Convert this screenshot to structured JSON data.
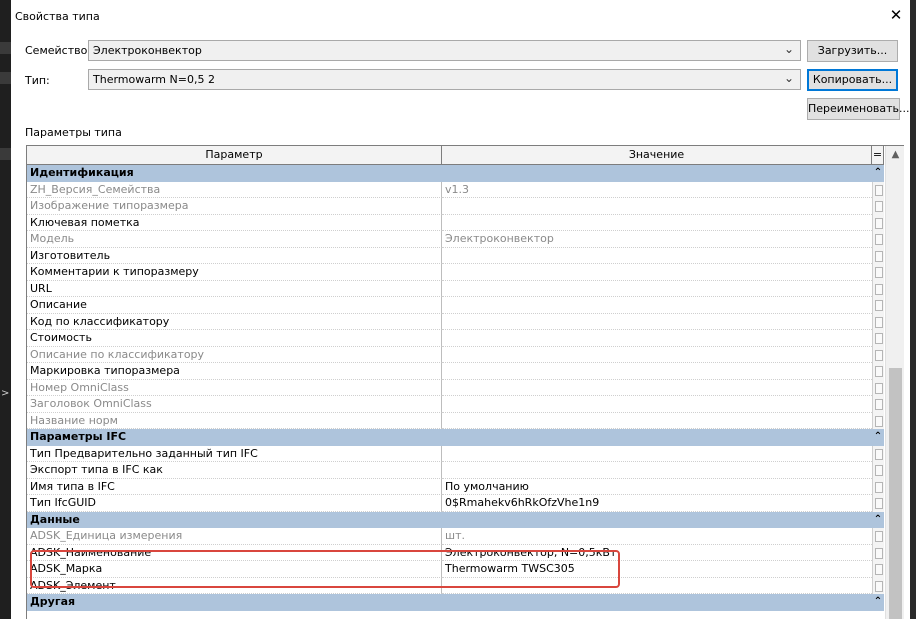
{
  "window": {
    "title": "Свойства типа",
    "close_glyph": "✕"
  },
  "family": {
    "label": "Семейство:",
    "value": "Электроконвектор",
    "load_button": "Загрузить..."
  },
  "type": {
    "label": "Тип:",
    "value": "Thermowarm N=0,5 2",
    "copy_button": "Копировать...",
    "rename_button": "Переименовать..."
  },
  "section_label": "Параметры типа",
  "grid": {
    "col_param": "Параметр",
    "col_value": "Значение",
    "col_eq": "=",
    "groups": [
      {
        "name": "Идентификация",
        "rows": [
          {
            "param": "ZH_Версия_Семейства",
            "value": "v1.3",
            "disabled": true
          },
          {
            "param": "Изображение типоразмера",
            "value": "",
            "disabled": true
          },
          {
            "param": "Ключевая пометка",
            "value": "",
            "disabled": false
          },
          {
            "param": "Модель",
            "value": "Электроконвектор",
            "disabled": true
          },
          {
            "param": "Изготовитель",
            "value": "",
            "disabled": false
          },
          {
            "param": "Комментарии к типоразмеру",
            "value": "",
            "disabled": false
          },
          {
            "param": "URL",
            "value": "",
            "disabled": false
          },
          {
            "param": "Описание",
            "value": "",
            "disabled": false
          },
          {
            "param": "Код по классификатору",
            "value": "",
            "disabled": false
          },
          {
            "param": "Стоимость",
            "value": "",
            "disabled": false
          },
          {
            "param": "Описание по классификатору",
            "value": "",
            "disabled": true
          },
          {
            "param": "Маркировка типоразмера",
            "value": "",
            "disabled": false
          },
          {
            "param": "Номер OmniClass",
            "value": "",
            "disabled": true
          },
          {
            "param": "Заголовок OmniClass",
            "value": "",
            "disabled": true
          },
          {
            "param": "Название норм",
            "value": "",
            "disabled": true
          }
        ]
      },
      {
        "name": "Параметры IFC",
        "rows": [
          {
            "param": "Тип Предварительно заданный тип IFC",
            "value": "",
            "disabled": false
          },
          {
            "param": "Экспорт типа в IFC как",
            "value": "",
            "disabled": false
          },
          {
            "param": "Имя типа в IFC",
            "value": "По умолчанию",
            "disabled": false
          },
          {
            "param": "Тип IfcGUID",
            "value": "0$Rmahekv6hRkOfzVhe1n9",
            "disabled": false
          }
        ]
      },
      {
        "name": "Данные",
        "rows": [
          {
            "param": "ADSK_Единица измерения",
            "value": "шт.",
            "disabled": true
          },
          {
            "param": "ADSK_Наименование",
            "value": "Электроконвектор, N=0,5кВт",
            "disabled": false
          },
          {
            "param": "ADSK_Марка",
            "value": "Thermowarm TWSC305",
            "disabled": false
          },
          {
            "param": "ADSK_Элемент",
            "value": "",
            "disabled": false
          }
        ]
      },
      {
        "name": "Другая",
        "rows": []
      }
    ]
  }
}
